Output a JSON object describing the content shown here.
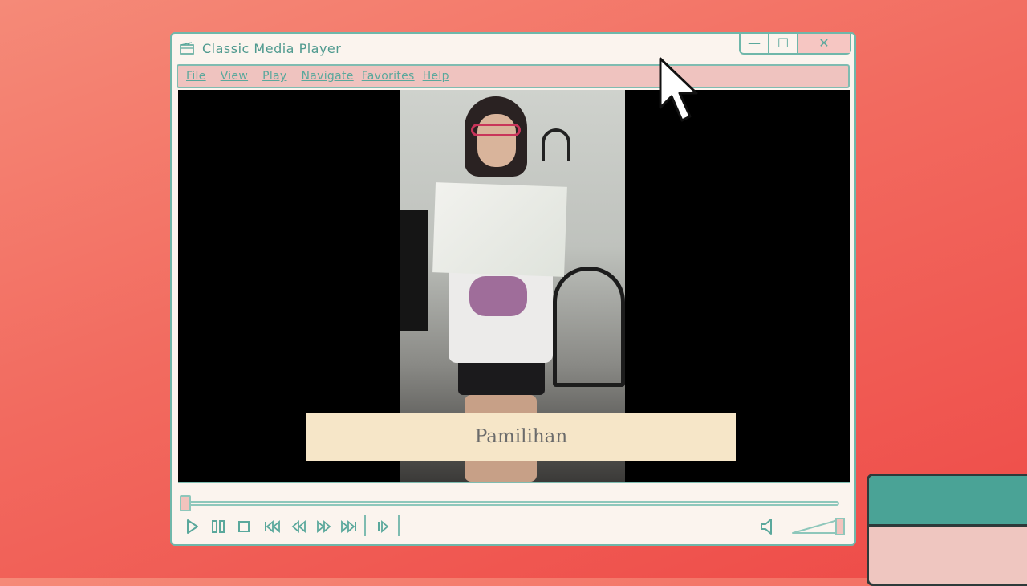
{
  "window": {
    "title": "Classic Media Player",
    "controls": {
      "minimize": "—",
      "maximize": "☐",
      "close": "✕"
    }
  },
  "menu": {
    "items": [
      "File",
      "View",
      "Play",
      "Navigate",
      "Favorites",
      "Help"
    ]
  },
  "video": {
    "caption": "Pamilihan",
    "seek_progress": 0.0
  },
  "icons": {
    "app": "media-player-icon",
    "play": "play-icon",
    "pause": "pause-icon",
    "stop": "stop-icon",
    "skip_back": "skip-back-icon",
    "rewind": "rewind-icon",
    "fast_forward": "fast-forward-icon",
    "skip_forward": "skip-forward-icon",
    "frame_step": "frame-step-icon",
    "volume": "speaker-icon"
  },
  "colors": {
    "accent": "#5aa89c",
    "menu_bg": "#efc3bf",
    "window_bg": "#fbf4ee",
    "caption_bg": "#f6e6c8",
    "background": "#f26a5f"
  },
  "volume": {
    "level": 1.0
  }
}
